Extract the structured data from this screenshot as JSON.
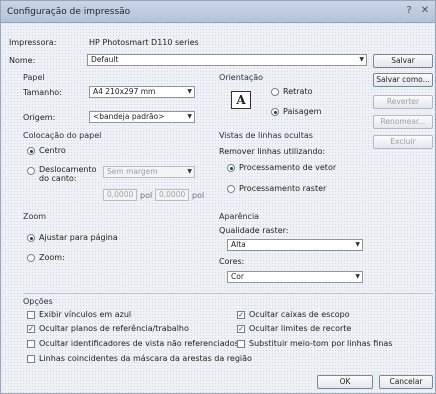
{
  "window": {
    "title": "Configuração de impressão"
  },
  "printer": {
    "section_label": "Impressora",
    "printer_label": "Impressora:",
    "printer_value": "HP Photosmart D110 series",
    "name_label": "Nome:",
    "name_value": "Default"
  },
  "paper": {
    "section_label": "Papel",
    "size_label": "Tamanho:",
    "size_value": "A4 210x297 mm",
    "source_label": "Origem:",
    "source_value": "<bandeja padrão>"
  },
  "orientation": {
    "section_label": "Orientação",
    "portrait_label": "Retrato",
    "landscape_label": "Paisagem",
    "icon_glyph": "A",
    "selected": "landscape"
  },
  "buttons": {
    "save": "Salvar",
    "save_as": "Salvar como...",
    "revert": "Reverter",
    "rename": "Renomear...",
    "delete": "Excluir",
    "ok": "OK",
    "cancel": "Cancelar"
  },
  "placement": {
    "section_label": "Colocação do papel",
    "center_label": "Centro",
    "offset_label": "Deslocamento do canto:",
    "offset_dropdown": "Sem margem",
    "x_value": "0,0000",
    "x_unit": "pol",
    "y_value": "0,0000",
    "y_unit": "pol",
    "selected": "center"
  },
  "hidden_lines": {
    "section_label": "Vistas de linhas ocultas",
    "remove_label": "Remover linhas utilizando:",
    "vector_label": "Processamento de vetor",
    "raster_label": "Processamento raster",
    "selected": "vector"
  },
  "zoom": {
    "section_label": "Zoom",
    "fit_label": "Ajustar para página",
    "zoom_label": "Zoom:",
    "selected": "fit"
  },
  "appearance": {
    "section_label": "Aparência",
    "raster_quality_label": "Qualidade raster:",
    "raster_quality_value": "Alta",
    "colors_label": "Cores:",
    "colors_value": "Cor"
  },
  "options": {
    "section_label": "Opções",
    "items": [
      {
        "label": "Exibir vínculos em azul",
        "checked": false
      },
      {
        "label": "Ocultar caixas de escopo",
        "checked": true
      },
      {
        "label": "Ocultar planos de referência/trabalho",
        "checked": true
      },
      {
        "label": "Ocultar limites de recorte",
        "checked": true
      },
      {
        "label": "Ocultar identificadores de vista não referenciados",
        "checked": false
      },
      {
        "label": "Substituir meio-tom por linhas finas",
        "checked": false
      },
      {
        "label": "Linhas coincidentes da máscara da arestas da região",
        "checked": false
      }
    ]
  }
}
